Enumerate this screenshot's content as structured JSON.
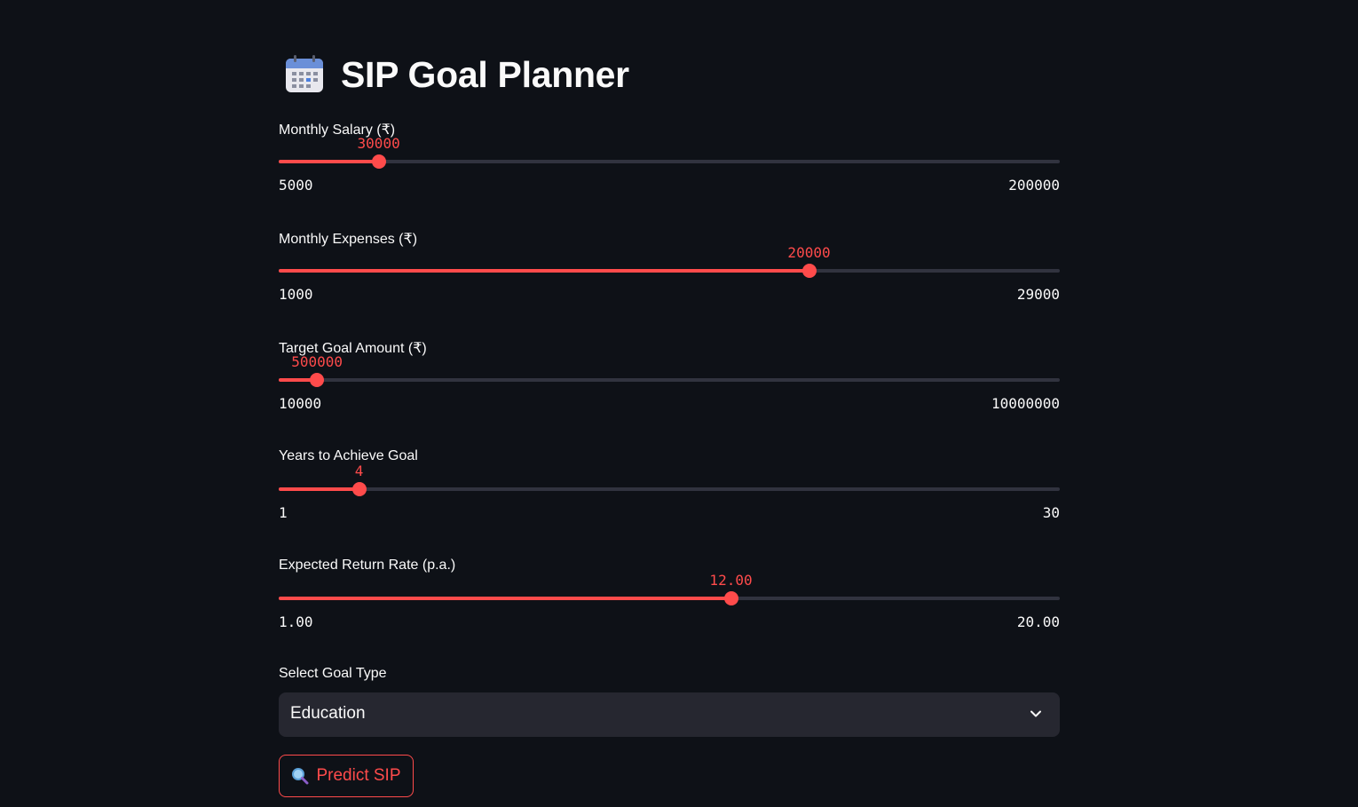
{
  "app": {
    "title": "SIP Goal Planner",
    "title_icon": "calendar-icon"
  },
  "colors": {
    "background": "#0e1117",
    "accent": "#ff4b4b",
    "track": "#31333f",
    "select_bg": "#262730",
    "text": "#fafafa"
  },
  "sliders": [
    {
      "label": "Monthly Salary (₹)",
      "value": "30000",
      "min": "5000",
      "max": "200000",
      "fraction": 0.128
    },
    {
      "label": "Monthly Expenses (₹)",
      "value": "20000",
      "min": "1000",
      "max": "29000",
      "fraction": 0.679
    },
    {
      "label": "Target Goal Amount (₹)",
      "value": "500000",
      "min": "10000",
      "max": "10000000",
      "fraction": 0.049
    },
    {
      "label": "Years to Achieve Goal",
      "value": "4",
      "min": "1",
      "max": "30",
      "fraction": 0.103
    },
    {
      "label": "Expected Return Rate (p.a.)",
      "value": "12.00",
      "min": "1.00",
      "max": "20.00",
      "fraction": 0.579
    }
  ],
  "goal_select": {
    "label": "Select Goal Type",
    "selected": "Education",
    "icon": "chevron-down-icon"
  },
  "predict_button": {
    "label": "Predict SIP",
    "icon": "magnifying-glass-icon"
  }
}
